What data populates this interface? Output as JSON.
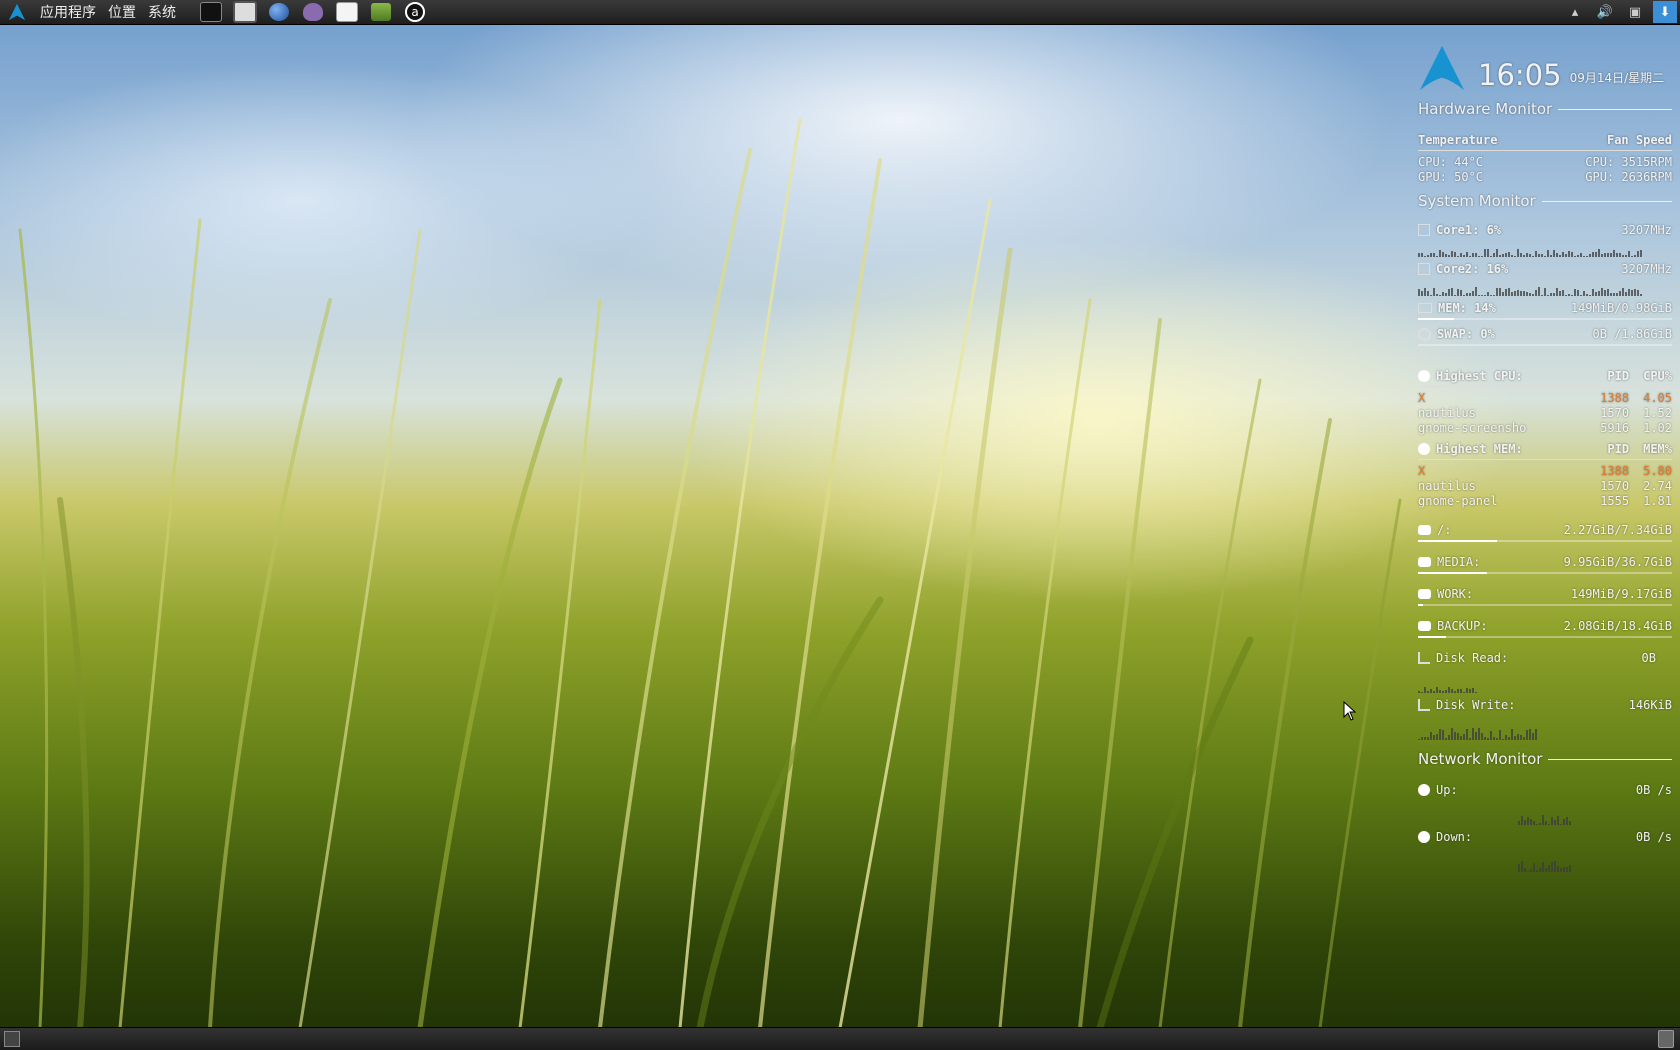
{
  "top_panel": {
    "menus": [
      "应用程序",
      "位置",
      "系统"
    ],
    "launchers": [
      {
        "icon": "terminal-icon",
        "color": "#222222"
      },
      {
        "icon": "monitor-icon",
        "color": "#cccccc"
      },
      {
        "icon": "globe-icon",
        "color": "#2a62b8"
      },
      {
        "icon": "pidgin-icon",
        "color": "#8a6bb0"
      },
      {
        "icon": "text-editor-icon",
        "color": "#eeeeee"
      },
      {
        "icon": "book-icon",
        "color": "#7aa23a"
      },
      {
        "icon": "amazon-icon",
        "color": "#111111"
      }
    ]
  },
  "clock": {
    "time": "16:05",
    "date": "09月14日/星期二"
  },
  "hardware": {
    "title": "Hardware Monitor",
    "temp_header": "Temperature",
    "fan_header": "Fan Speed",
    "cpu_temp": "CPU: 44°C",
    "gpu_temp": "GPU: 50°C",
    "cpu_fan": "CPU: 3515RPM",
    "gpu_fan": "GPU: 2636RPM"
  },
  "system": {
    "title": "System Monitor",
    "core1": {
      "label": "Core1: 6%",
      "freq": "3207MHz"
    },
    "core2": {
      "label": "Core2: 16%",
      "freq": "3207MHz"
    },
    "mem": {
      "label": "MEM: 14%",
      "value": "149MiB/0.98GiB",
      "percent": 14
    },
    "swap": {
      "label": "SWAP: 0%",
      "value": "0B  /1.86GiB",
      "percent": 0
    }
  },
  "top_cpu": {
    "header": "Highest CPU:",
    "pid_header": "PID",
    "val_header": "CPU%",
    "rows": [
      {
        "name": "X",
        "pid": "1388",
        "val": "4.05"
      },
      {
        "name": "nautilus",
        "pid": "1570",
        "val": "1.52"
      },
      {
        "name": "gnome-screensho",
        "pid": "5916",
        "val": "1.02"
      }
    ]
  },
  "top_mem": {
    "header": "Highest MEM:",
    "pid_header": "PID",
    "val_header": "MEM%",
    "rows": [
      {
        "name": "X",
        "pid": "1388",
        "val": "5.80"
      },
      {
        "name": "nautilus",
        "pid": "1570",
        "val": "2.74"
      },
      {
        "name": "gnome-panel",
        "pid": "1555",
        "val": "1.81"
      }
    ]
  },
  "disks": [
    {
      "label": "/:",
      "value": "2.27GiB/7.34GiB",
      "fraction": 0.31
    },
    {
      "label": "MEDIA:",
      "value": "9.95GiB/36.7GiB",
      "fraction": 0.27
    },
    {
      "label": "WORK:",
      "value": "149MiB/9.17GiB",
      "fraction": 0.02
    },
    {
      "label": "BACKUP:",
      "value": "2.08GiB/18.4GiB",
      "fraction": 0.11
    }
  ],
  "disk_io": {
    "read_label": "Disk Read:",
    "read_value": "0B",
    "write_label": "Disk Write:",
    "write_value": "146KiB"
  },
  "network": {
    "title": "Network Monitor",
    "up_label": "Up:",
    "up_value": "0B  /s",
    "down_label": "Down:",
    "down_value": "0B  /s"
  }
}
